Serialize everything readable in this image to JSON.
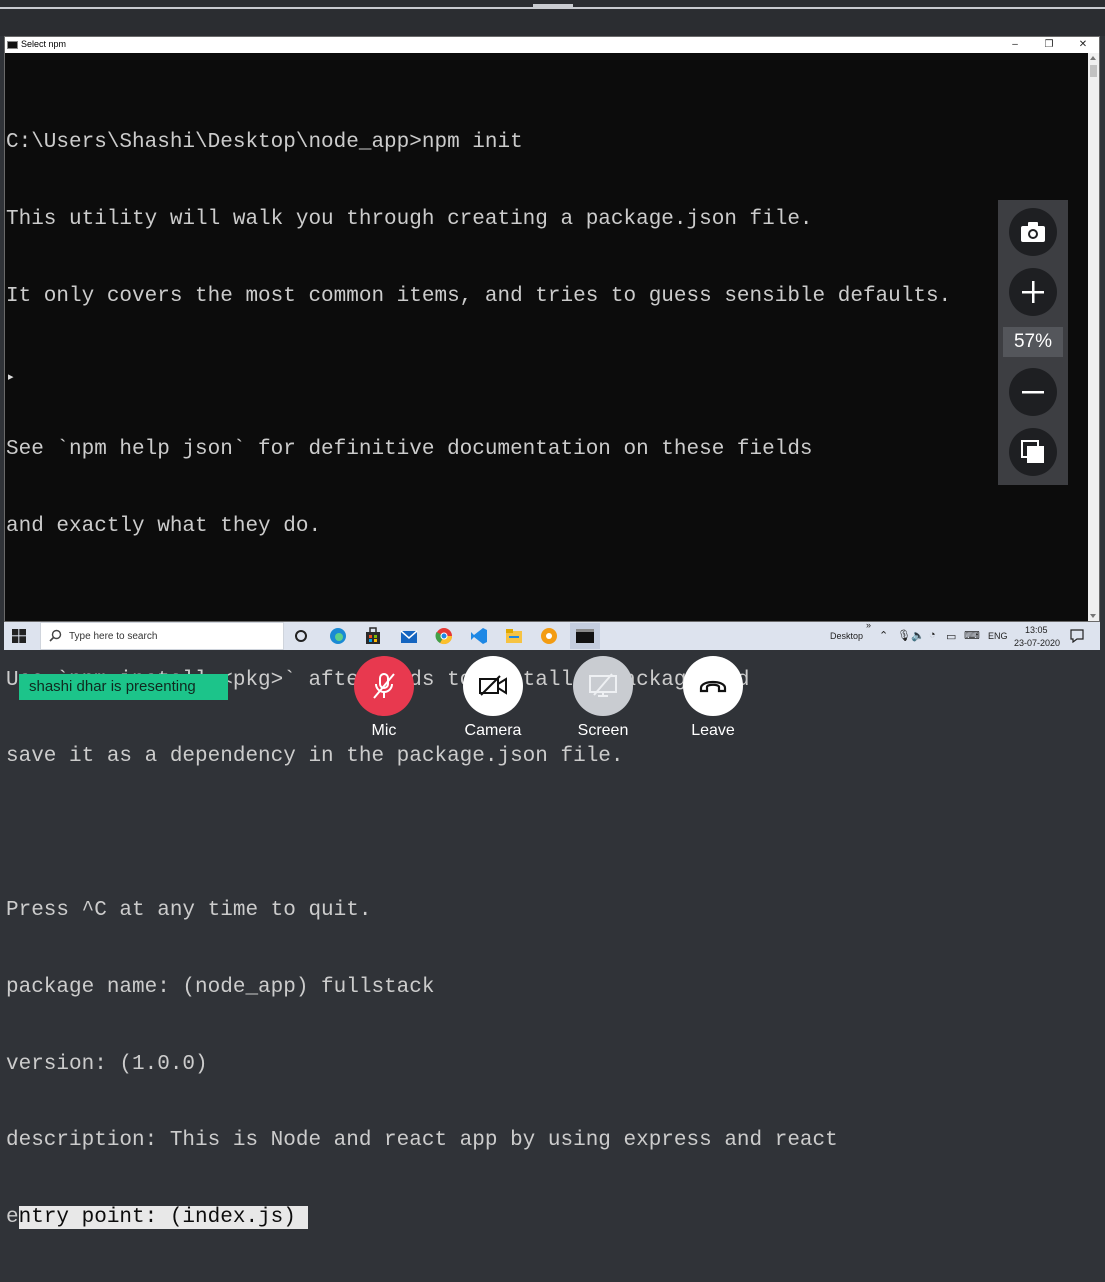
{
  "console": {
    "title": "Select npm",
    "lines": [
      "C:\\Users\\Shashi\\Desktop\\node_app>npm init",
      "This utility will walk you through creating a package.json file.",
      "It only covers the most common items, and tries to guess sensible defaults.",
      "",
      "See `npm help json` for definitive documentation on these fields",
      "and exactly what they do.",
      "",
      "Use `npm install <pkg>` afterwards to install a package and",
      "save it as a dependency in the package.json file.",
      "",
      "Press ^C at any time to quit.",
      "package name: (node_app) fullstack",
      "version: (1.0.0)",
      "description: This is Node and react app by using express and react"
    ],
    "last_line_prefix": "e",
    "last_line_selected": "ntry point: (index.js) "
  },
  "zoom": {
    "level": "57%"
  },
  "taskbar": {
    "search_placeholder": "Type here to search",
    "desktop_label": "Desktop",
    "language": "ENG",
    "time": "13:05",
    "date": "23-07-2020",
    "chevron": "»"
  },
  "meeting": {
    "presenter_banner": "shashi dhar is presenting",
    "controls": {
      "mic": "Mic",
      "camera": "Camera",
      "screen": "Screen",
      "leave": "Leave"
    },
    "colors": {
      "mic": "#e8394f",
      "camera": "#ffffff",
      "screen": "#c9ccd1",
      "leave": "#ffffff",
      "banner": "#1cc48a"
    }
  }
}
